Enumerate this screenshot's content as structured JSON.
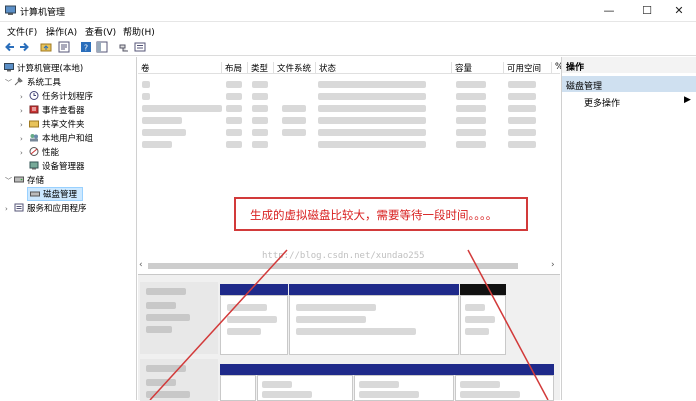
{
  "window": {
    "title": "计算机管理",
    "controls": {
      "minimize": "—",
      "maximize": "☐",
      "close": "✕"
    }
  },
  "menu": [
    "文件(F)",
    "操作(A)",
    "查看(V)",
    "帮助(H)"
  ],
  "toolbar_icons": [
    "back-icon",
    "forward-icon",
    "up-folder-icon",
    "properties-icon",
    "help-icon",
    "show-pane-icon",
    "connect-icon",
    "list-view-icon"
  ],
  "tree": {
    "root": "计算机管理(本地)",
    "system_tools": "系统工具",
    "task_scheduler": "任务计划程序",
    "event_viewer": "事件查看器",
    "shared_folders": "共享文件夹",
    "local_users": "本地用户和组",
    "performance": "性能",
    "device_manager": "设备管理器",
    "storage": "存储",
    "disk_management": "磁盘管理",
    "services_apps": "服务和应用程序"
  },
  "columns": [
    "卷",
    "布局",
    "类型",
    "文件系统",
    "状态",
    "容量",
    "可用空间",
    "%"
  ],
  "actions": {
    "header": "操作",
    "section": "磁盘管理",
    "more": "更多操作"
  },
  "annotation": {
    "text": "生成的虚拟磁盘比较大，需要等待一段时间。。。。",
    "watermark": "http://blog.csdn.net/xundao255",
    "color": "#d23a3a"
  },
  "colors": {
    "disk_bar": "#1f2a8a",
    "selected": "#cce8ff"
  }
}
